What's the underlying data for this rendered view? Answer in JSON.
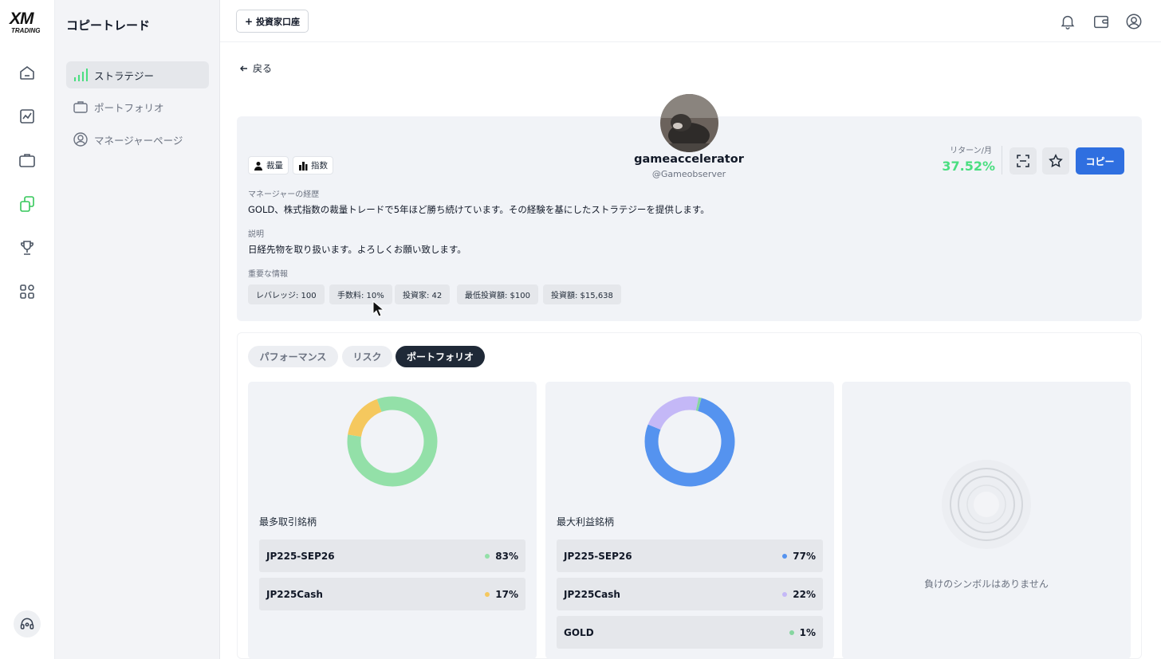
{
  "brand": {
    "logo_main": "XM",
    "logo_sub": "TRADING"
  },
  "sidebar": {
    "title": "コピートレード",
    "items": [
      {
        "label": "ストラテジー",
        "icon": "signal-bars-icon",
        "active": true
      },
      {
        "label": "ポートフォリオ",
        "icon": "briefcase-icon",
        "active": false
      },
      {
        "label": "マネージャーページ",
        "icon": "user-circle-icon",
        "active": false
      }
    ]
  },
  "rail": {
    "icons": [
      "home-icon",
      "chart-icon",
      "briefcase-icon",
      "copy-trade-icon",
      "trophy-icon",
      "apps-icon",
      "headset-icon"
    ]
  },
  "topbar": {
    "invest_button": "投資家口座",
    "icons": [
      "bell-icon",
      "wallet-icon",
      "user-icon"
    ]
  },
  "back_label": "戻る",
  "profile": {
    "name": "gameaccelerator",
    "handle": "@Gameobserver",
    "tags": [
      {
        "label": "裁量",
        "icon": "person-icon"
      },
      {
        "label": "指数",
        "icon": "bar-chart-icon"
      }
    ],
    "history_label": "マネージャーの経歴",
    "history_text": "GOLD、株式指数の裁量トレードで5年ほど勝ち続けています。その経験を基にしたストラテジーを提供します。",
    "description_label": "説明",
    "description_text": "日経先物を取り扱います。よろしくお願い致します。",
    "info_label": "重要な情報",
    "chips": [
      "レバレッジ: 100",
      "手数料: 10%",
      "投資家: 42",
      "最低投資額: $100",
      "投資額: $15,638"
    ],
    "return_label": "リターン/月",
    "return_value": "37.52%",
    "copy_button": "コピー",
    "accent_color": "#2f6fe0",
    "return_color": "#4ade80"
  },
  "tabs": [
    {
      "label": "パフォーマンス",
      "active": false
    },
    {
      "label": "リスク",
      "active": false
    },
    {
      "label": "ポートフォリオ",
      "active": true
    }
  ],
  "panels": {
    "most_traded": {
      "title": "最多取引銘柄",
      "rows": [
        {
          "symbol": "JP225-SEP26",
          "pct": "83%",
          "color": "#93e0a8"
        },
        {
          "symbol": "JP225Cash",
          "pct": "17%",
          "color": "#f5c85e"
        }
      ]
    },
    "most_profitable": {
      "title": "最大利益銘柄",
      "rows": [
        {
          "symbol": "JP225-SEP26",
          "pct": "77%",
          "color": "#5593ef"
        },
        {
          "symbol": "JP225Cash",
          "pct": "22%",
          "color": "#c4b8f7"
        },
        {
          "symbol": "GOLD",
          "pct": "1%",
          "color": "#86d6a0"
        }
      ]
    },
    "losing": {
      "empty_text": "負けのシンボルはありません"
    }
  },
  "chart_data": [
    {
      "type": "pie",
      "categories": [
        "JP225-SEP26",
        "JP225Cash"
      ],
      "values": [
        83,
        17
      ],
      "colors": [
        "#93e0a8",
        "#f5c85e"
      ],
      "title": "最多取引銘柄"
    },
    {
      "type": "pie",
      "categories": [
        "JP225-SEP26",
        "JP225Cash",
        "GOLD"
      ],
      "values": [
        77,
        22,
        1
      ],
      "colors": [
        "#5593ef",
        "#c4b8f7",
        "#86d6a0"
      ],
      "title": "最大利益銘柄"
    }
  ]
}
